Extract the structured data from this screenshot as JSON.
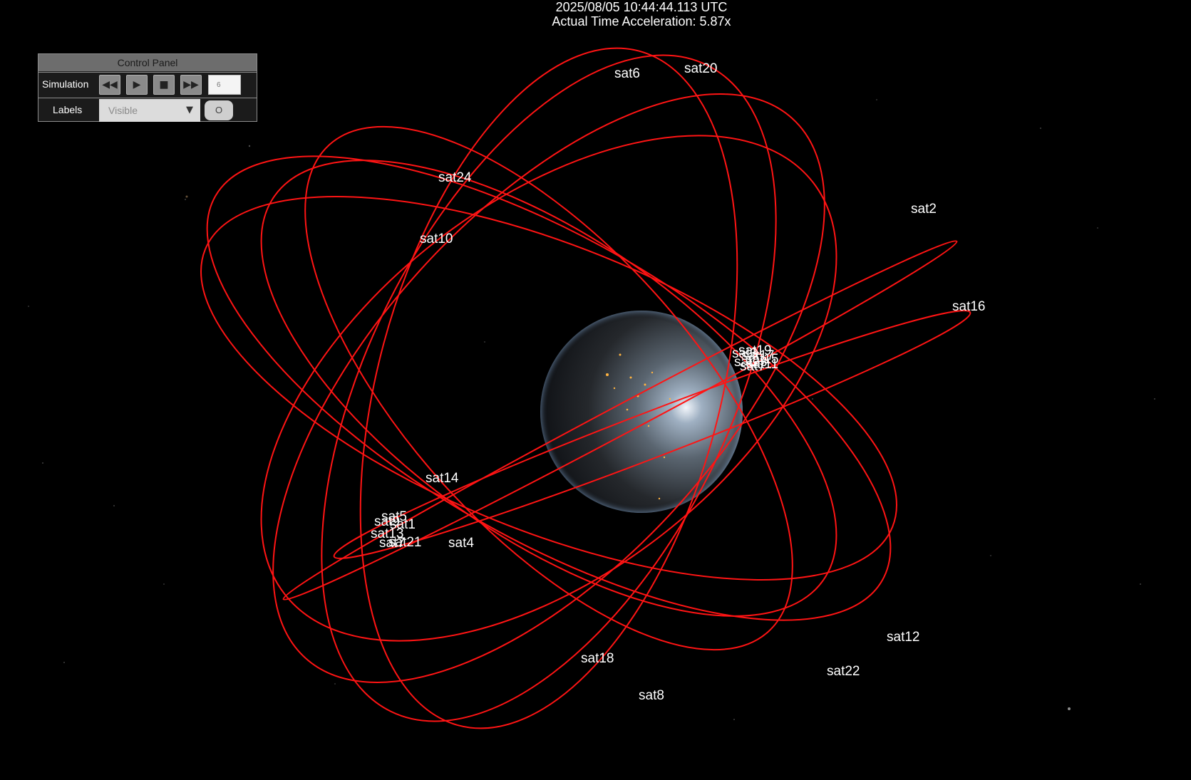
{
  "hud": {
    "timestamp": "2025/08/05 10:44:44.113 UTC",
    "acceleration": "Actual Time Acceleration: 5.87x"
  },
  "control_panel": {
    "title": "Control Panel",
    "simulation_label": "Simulation",
    "speed_value": "6",
    "labels_label": "Labels",
    "labels_option": "Visible",
    "labels_toggle": "O",
    "icons": {
      "rewind": "rewind-icon",
      "play": "play-icon",
      "stop": "stop-icon",
      "fast_forward": "fast-forward-icon",
      "dropdown": "chevron-down-icon"
    }
  },
  "scene": {
    "background_color": "#000000",
    "orbit_color": "#ff1414",
    "label_color": "#ffffff",
    "satellites": [
      "sat1",
      "sat2",
      "sat3",
      "sat4",
      "sat5",
      "sat6",
      "sat7",
      "sat8",
      "sat9",
      "sat10",
      "sat11",
      "sat12",
      "sat13",
      "sat14",
      "sat15",
      "sat16",
      "sat17",
      "sat18",
      "sat19",
      "sat20",
      "sat21",
      "sat22",
      "sat23",
      "sat24"
    ]
  }
}
